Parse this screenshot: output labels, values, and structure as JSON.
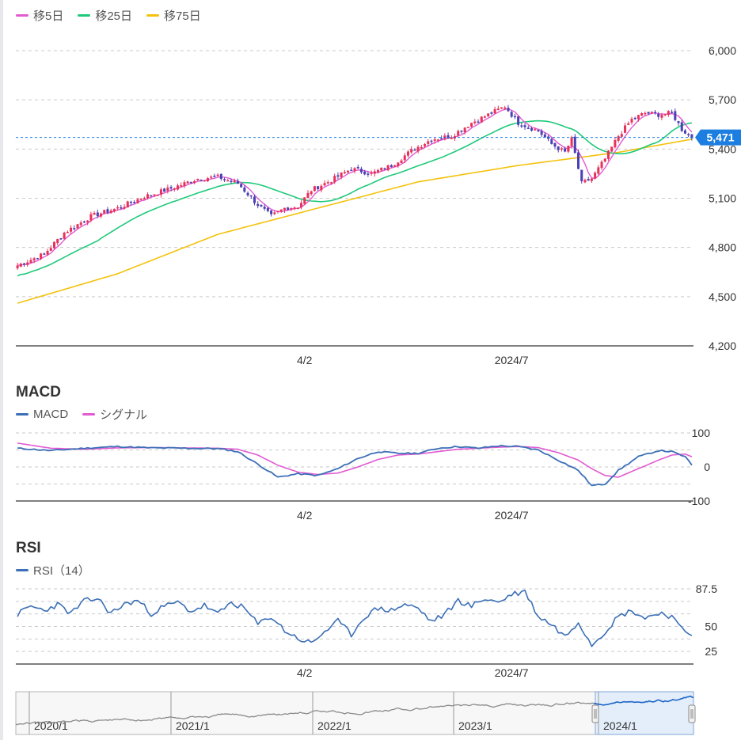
{
  "colors": {
    "up": "#e8325a",
    "down": "#4b41b5",
    "ma5": "#e25ad2",
    "ma25": "#1fc97a",
    "ma75": "#f4c20d",
    "macd": "#3b6fb6",
    "signal": "#e25ad2",
    "rsi": "#3b6fb6",
    "price_tag": "#1c7ee0",
    "grid": "#c9c9c9",
    "axis": "#333333"
  },
  "main_legend": [
    {
      "label": "移5日",
      "color": "#e25ad2"
    },
    {
      "label": "移25日",
      "color": "#1fc97a"
    },
    {
      "label": "移75日",
      "color": "#f4c20d"
    }
  ],
  "macd_panel": {
    "title": "MACD",
    "legend": [
      {
        "label": "MACD",
        "color": "#3b6fb6"
      },
      {
        "label": "シグナル",
        "color": "#e25ad2"
      }
    ]
  },
  "rsi_panel": {
    "title": "RSI",
    "legend": [
      {
        "label": "RSI（14）",
        "color": "#3b6fb6"
      }
    ]
  },
  "current_price_label": "5,471",
  "navigator": {
    "labels": [
      "2020/1",
      "2021/1",
      "2022/1",
      "2023/1",
      "2024/1"
    ]
  },
  "chart_data": [
    {
      "type": "candlestick",
      "title": "",
      "ylim": [
        4200,
        6000
      ],
      "yticks": [
        4200,
        4500,
        4800,
        5100,
        5400,
        5700,
        6000
      ],
      "ytick_labels": [
        "4,200",
        "4,500",
        "4,800",
        "5,100",
        "5,400",
        "5,700",
        "6,000"
      ],
      "xtick_labels": [
        "4/2",
        "2024/7"
      ],
      "last_price": 5471,
      "series_close_keypoints": [
        [
          0,
          4690
        ],
        [
          8,
          4760
        ],
        [
          14,
          4890
        ],
        [
          22,
          4990
        ],
        [
          30,
          5040
        ],
        [
          38,
          5110
        ],
        [
          46,
          5160
        ],
        [
          54,
          5220
        ],
        [
          60,
          5230
        ],
        [
          66,
          5190
        ],
        [
          72,
          5060
        ],
        [
          76,
          4990
        ],
        [
          80,
          5040
        ],
        [
          84,
          5050
        ],
        [
          88,
          5150
        ],
        [
          94,
          5210
        ],
        [
          100,
          5280
        ],
        [
          106,
          5250
        ],
        [
          112,
          5300
        ],
        [
          118,
          5390
        ],
        [
          124,
          5460
        ],
        [
          130,
          5480
        ],
        [
          136,
          5560
        ],
        [
          142,
          5620
        ],
        [
          146,
          5660
        ],
        [
          150,
          5560
        ],
        [
          156,
          5510
        ],
        [
          160,
          5430
        ],
        [
          164,
          5380
        ],
        [
          166,
          5460
        ],
        [
          169,
          5190
        ],
        [
          172,
          5220
        ],
        [
          176,
          5340
        ],
        [
          180,
          5480
        ],
        [
          184,
          5580
        ],
        [
          188,
          5620
        ],
        [
          192,
          5610
        ],
        [
          196,
          5620
        ],
        [
          199,
          5520
        ],
        [
          202,
          5471
        ]
      ],
      "moving_averages": [
        {
          "name": "移5日",
          "period": 5
        },
        {
          "name": "移25日",
          "period": 25
        },
        {
          "name": "移75日",
          "period": 75
        }
      ],
      "ma75_keypoints": [
        [
          0,
          4460
        ],
        [
          30,
          4640
        ],
        [
          60,
          4880
        ],
        [
          90,
          5040
        ],
        [
          120,
          5200
        ],
        [
          150,
          5300
        ],
        [
          180,
          5380
        ],
        [
          202,
          5460
        ]
      ]
    },
    {
      "type": "line",
      "title": "MACD",
      "ylim": [
        -100,
        100
      ],
      "ytick_labels": [
        "100",
        "0",
        "-100"
      ],
      "xtick_labels": [
        "4/2",
        "2024/7"
      ],
      "series": [
        {
          "name": "MACD",
          "keypoints": [
            [
              0,
              55
            ],
            [
              10,
              48
            ],
            [
              20,
              55
            ],
            [
              30,
              60
            ],
            [
              40,
              56
            ],
            [
              50,
              55
            ],
            [
              60,
              54
            ],
            [
              66,
              45
            ],
            [
              72,
              8
            ],
            [
              78,
              -30
            ],
            [
              84,
              -20
            ],
            [
              90,
              -25
            ],
            [
              96,
              -5
            ],
            [
              102,
              25
            ],
            [
              108,
              45
            ],
            [
              114,
              40
            ],
            [
              120,
              40
            ],
            [
              126,
              55
            ],
            [
              132,
              60
            ],
            [
              138,
              55
            ],
            [
              144,
              62
            ],
            [
              150,
              60
            ],
            [
              156,
              50
            ],
            [
              162,
              20
            ],
            [
              168,
              -10
            ],
            [
              172,
              -55
            ],
            [
              176,
              -50
            ],
            [
              180,
              -10
            ],
            [
              186,
              30
            ],
            [
              192,
              48
            ],
            [
              196,
              45
            ],
            [
              200,
              30
            ],
            [
              202,
              5
            ]
          ]
        },
        {
          "name": "シグナル",
          "keypoints": [
            [
              0,
              70
            ],
            [
              10,
              55
            ],
            [
              20,
              52
            ],
            [
              30,
              56
            ],
            [
              40,
              57
            ],
            [
              50,
              56
            ],
            [
              60,
              55
            ],
            [
              66,
              52
            ],
            [
              72,
              35
            ],
            [
              78,
              5
            ],
            [
              84,
              -15
            ],
            [
              90,
              -22
            ],
            [
              96,
              -18
            ],
            [
              102,
              0
            ],
            [
              108,
              22
            ],
            [
              114,
              35
            ],
            [
              120,
              38
            ],
            [
              126,
              45
            ],
            [
              132,
              52
            ],
            [
              138,
              55
            ],
            [
              144,
              58
            ],
            [
              150,
              60
            ],
            [
              156,
              57
            ],
            [
              162,
              42
            ],
            [
              168,
              20
            ],
            [
              172,
              -5
            ],
            [
              176,
              -25
            ],
            [
              180,
              -30
            ],
            [
              186,
              -5
            ],
            [
              192,
              20
            ],
            [
              196,
              35
            ],
            [
              200,
              38
            ],
            [
              202,
              30
            ]
          ]
        }
      ]
    },
    {
      "type": "line",
      "title": "RSI",
      "ylim": [
        25,
        87.5
      ],
      "ytick_labels": [
        "87.5",
        "50",
        "25"
      ],
      "xtick_labels": [
        "4/2",
        "2024/7"
      ],
      "series": [
        {
          "name": "RSI（14）",
          "keypoints": [
            [
              0,
              62
            ],
            [
              4,
              70
            ],
            [
              8,
              66
            ],
            [
              12,
              72
            ],
            [
              16,
              63
            ],
            [
              20,
              75
            ],
            [
              24,
              78
            ],
            [
              28,
              63
            ],
            [
              32,
              72
            ],
            [
              36,
              76
            ],
            [
              40,
              63
            ],
            [
              44,
              70
            ],
            [
              48,
              74
            ],
            [
              52,
              65
            ],
            [
              56,
              71
            ],
            [
              60,
              62
            ],
            [
              64,
              74
            ],
            [
              68,
              68
            ],
            [
              72,
              52
            ],
            [
              76,
              60
            ],
            [
              80,
              46
            ],
            [
              84,
              38
            ],
            [
              88,
              33
            ],
            [
              92,
              45
            ],
            [
              96,
              55
            ],
            [
              100,
              42
            ],
            [
              104,
              60
            ],
            [
              108,
              68
            ],
            [
              112,
              66
            ],
            [
              116,
              72
            ],
            [
              120,
              68
            ],
            [
              124,
              55
            ],
            [
              128,
              62
            ],
            [
              132,
              76
            ],
            [
              136,
              70
            ],
            [
              140,
              78
            ],
            [
              144,
              74
            ],
            [
              148,
              82
            ],
            [
              152,
              85
            ],
            [
              156,
              60
            ],
            [
              160,
              52
            ],
            [
              164,
              40
            ],
            [
              168,
              55
            ],
            [
              172,
              32
            ],
            [
              176,
              45
            ],
            [
              180,
              60
            ],
            [
              184,
              66
            ],
            [
              188,
              58
            ],
            [
              192,
              64
            ],
            [
              196,
              60
            ],
            [
              198,
              50
            ],
            [
              202,
              42
            ]
          ]
        }
      ]
    }
  ]
}
